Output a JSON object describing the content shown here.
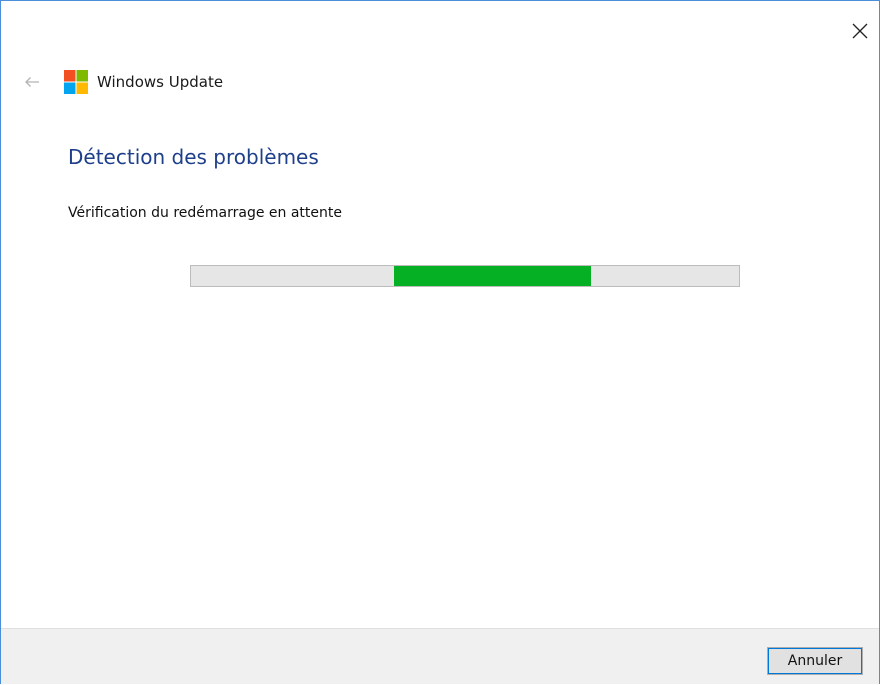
{
  "window": {
    "app_title": "Windows Update",
    "icons": {
      "close": "close-icon",
      "back": "back-arrow-icon",
      "app": "windows-update-logo-icon"
    }
  },
  "main": {
    "heading": "Détection des problèmes",
    "status": "Vérification du redémarrage en attente",
    "progress": {
      "state": "indeterminate",
      "segment_start_fraction": 0.37,
      "segment_end_fraction": 0.73,
      "fill_color": "#06b025",
      "track_color": "#e6e6e6"
    }
  },
  "footer": {
    "cancel_label": "Annuler"
  },
  "colors": {
    "heading": "#1e3f8a",
    "window_border": "#4a90d9",
    "logo": [
      "#f25022",
      "#7fba00",
      "#00a4ef",
      "#ffb900"
    ]
  }
}
